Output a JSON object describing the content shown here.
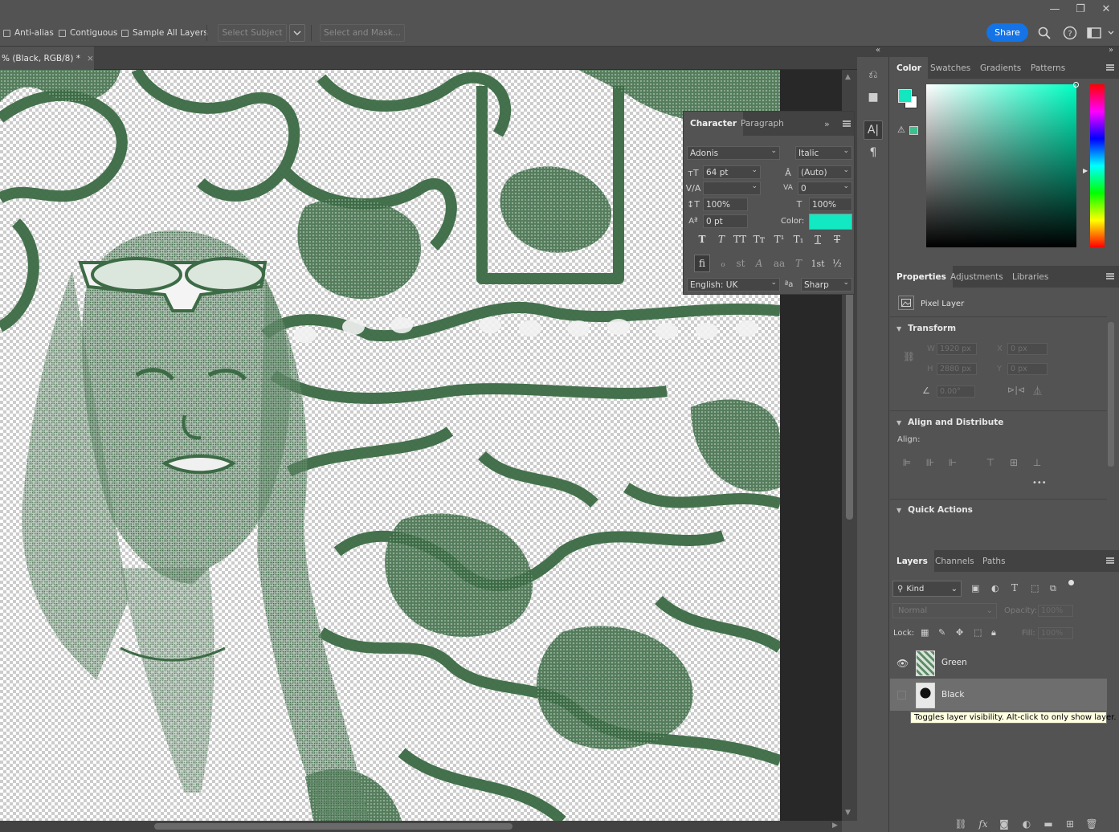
{
  "window": {
    "minimize": "—",
    "restore": "❐",
    "close": "✕"
  },
  "options_bar": {
    "anti_alias": "Anti-alias",
    "contiguous": "Contiguous",
    "sample_all_layers": "Sample All Layers",
    "select_subject": "Select Subject",
    "select_and_mask": "Select and Mask...",
    "share": "Share"
  },
  "document": {
    "tab_title": "% (Black, RGB/8) *",
    "close": "×"
  },
  "character_panel": {
    "tabs": [
      "Character",
      "Paragraph"
    ],
    "font_family": "Adonis",
    "font_style": "Italic",
    "font_size": "64 pt",
    "leading": "(Auto)",
    "kerning": "",
    "tracking": "0",
    "vertical_scale": "100%",
    "horizontal_scale": "100%",
    "baseline_shift": "0 pt",
    "color_label": "Color:",
    "color": "#12e8c2",
    "language": "English: UK",
    "antialias": "Sharp",
    "style_buttons": [
      "T",
      "T",
      "TT",
      "Tт",
      "T¹",
      "T₁",
      "T",
      "T"
    ],
    "ot_buttons": [
      "fi",
      "ℴ",
      "st",
      "A",
      "aa",
      "T",
      "1st",
      "½"
    ]
  },
  "color_panel": {
    "tabs": [
      "Color",
      "Swatches",
      "Gradients",
      "Patterns"
    ],
    "foreground": "#14e6bf",
    "background": "#ffffff",
    "gamut_swatch": "#3fbf8e"
  },
  "properties_panel": {
    "tabs": [
      "Properties",
      "Adjustments",
      "Libraries"
    ],
    "layer_type": "Pixel Layer",
    "transform": {
      "title": "Transform",
      "w_label": "W",
      "w": "1920 px",
      "h_label": "H",
      "h": "2880 px",
      "x_label": "X",
      "x": "0 px",
      "y_label": "Y",
      "y": "0 px",
      "angle": "0.00°"
    },
    "align": {
      "title": "Align and Distribute",
      "label": "Align:",
      "more": "•••"
    },
    "quick_actions": {
      "title": "Quick Actions"
    }
  },
  "layers_panel": {
    "tabs": [
      "Layers",
      "Channels",
      "Paths"
    ],
    "filter": "Kind",
    "blend_mode": "Normal",
    "opacity_label": "Opacity:",
    "opacity": "100%",
    "lock_label": "Lock:",
    "fill_label": "Fill:",
    "fill": "100%",
    "layers": [
      {
        "name": "Green",
        "visible": true,
        "selected": false
      },
      {
        "name": "Black",
        "visible": false,
        "selected": true
      }
    ],
    "tooltip": "Toggles layer visibility. Alt-click to only show layer."
  },
  "colors": {
    "accent_blue": "#1473e6",
    "canvas_green": "#3c6b45"
  }
}
